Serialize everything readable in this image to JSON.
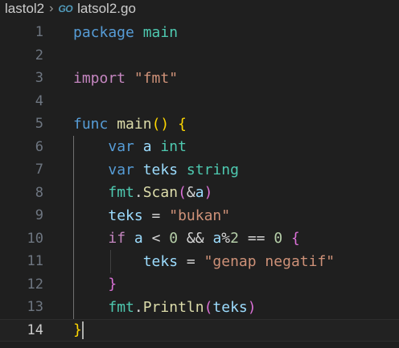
{
  "breadcrumb": {
    "folder": "lastol2",
    "separator": "›",
    "file_icon": "go-icon",
    "file_icon_text": "GO",
    "file": "latsol2.go"
  },
  "colors": {
    "background": "#1f1f1f",
    "keyword": "#569cd6",
    "control": "#c586c0",
    "function": "#dcdcaa",
    "type": "#4ec9b0",
    "string": "#ce9178",
    "number": "#b5cea8",
    "variable": "#9cdcfe",
    "plain": "#d4d4d4",
    "bracket1": "#ffd700",
    "bracket2": "#da70d6",
    "bracket3": "#179fff"
  },
  "editor": {
    "current_line": 14,
    "lines": [
      {
        "number": "1",
        "tokens": [
          {
            "t": "package",
            "c": "keyword"
          },
          {
            "t": " "
          },
          {
            "t": "main",
            "c": "type"
          }
        ]
      },
      {
        "number": "2",
        "tokens": []
      },
      {
        "number": "3",
        "tokens": [
          {
            "t": "import",
            "c": "control"
          },
          {
            "t": " "
          },
          {
            "t": "\"fmt\"",
            "c": "string"
          }
        ]
      },
      {
        "number": "4",
        "tokens": []
      },
      {
        "number": "5",
        "tokens": [
          {
            "t": "func",
            "c": "keyword"
          },
          {
            "t": " "
          },
          {
            "t": "main",
            "c": "function"
          },
          {
            "t": "()",
            "c": "bracket1"
          },
          {
            "t": " "
          },
          {
            "t": "{",
            "c": "bracket1"
          }
        ]
      },
      {
        "number": "6",
        "tokens": [
          {
            "t": "    "
          },
          {
            "t": "var",
            "c": "keyword"
          },
          {
            "t": " "
          },
          {
            "t": "a",
            "c": "variable"
          },
          {
            "t": " "
          },
          {
            "t": "int",
            "c": "type"
          }
        ]
      },
      {
        "number": "7",
        "tokens": [
          {
            "t": "    "
          },
          {
            "t": "var",
            "c": "keyword"
          },
          {
            "t": " "
          },
          {
            "t": "teks",
            "c": "variable"
          },
          {
            "t": " "
          },
          {
            "t": "string",
            "c": "type"
          }
        ]
      },
      {
        "number": "8",
        "tokens": [
          {
            "t": "    "
          },
          {
            "t": "fmt",
            "c": "type"
          },
          {
            "t": "."
          },
          {
            "t": "Scan",
            "c": "function"
          },
          {
            "t": "(",
            "c": "bracket2"
          },
          {
            "t": "&"
          },
          {
            "t": "a",
            "c": "variable"
          },
          {
            "t": ")",
            "c": "bracket2"
          }
        ]
      },
      {
        "number": "9",
        "tokens": [
          {
            "t": "    "
          },
          {
            "t": "teks",
            "c": "variable"
          },
          {
            "t": " = "
          },
          {
            "t": "\"bukan\"",
            "c": "string"
          }
        ]
      },
      {
        "number": "10",
        "tokens": [
          {
            "t": "    "
          },
          {
            "t": "if",
            "c": "control"
          },
          {
            "t": " "
          },
          {
            "t": "a",
            "c": "variable"
          },
          {
            "t": " < "
          },
          {
            "t": "0",
            "c": "number"
          },
          {
            "t": " && "
          },
          {
            "t": "a",
            "c": "variable"
          },
          {
            "t": "%"
          },
          {
            "t": "2",
            "c": "number"
          },
          {
            "t": " == "
          },
          {
            "t": "0",
            "c": "number"
          },
          {
            "t": " "
          },
          {
            "t": "{",
            "c": "bracket2"
          }
        ]
      },
      {
        "number": "11",
        "tokens": [
          {
            "t": "        "
          },
          {
            "t": "teks",
            "c": "variable"
          },
          {
            "t": " = "
          },
          {
            "t": "\"genap negatif\"",
            "c": "string"
          }
        ]
      },
      {
        "number": "12",
        "tokens": [
          {
            "t": "    "
          },
          {
            "t": "}",
            "c": "bracket2"
          }
        ]
      },
      {
        "number": "13",
        "tokens": [
          {
            "t": "    "
          },
          {
            "t": "fmt",
            "c": "type"
          },
          {
            "t": "."
          },
          {
            "t": "Println",
            "c": "function"
          },
          {
            "t": "(",
            "c": "bracket2"
          },
          {
            "t": "teks",
            "c": "variable"
          },
          {
            "t": ")",
            "c": "bracket2"
          }
        ]
      },
      {
        "number": "14",
        "tokens": [
          {
            "t": "}",
            "c": "bracket1"
          }
        ]
      }
    ]
  }
}
